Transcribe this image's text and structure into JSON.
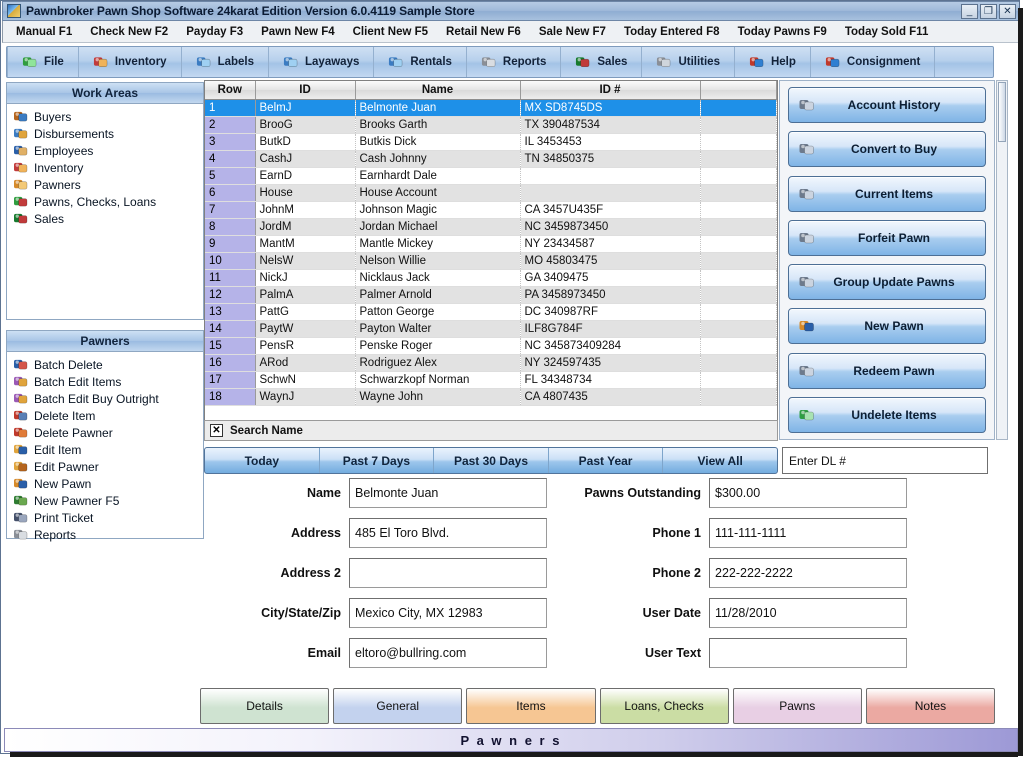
{
  "window": {
    "title": "Pawnbroker Pawn Shop Software 24karat Edition Version 6.0.4119 Sample Store",
    "minimize": "_",
    "maximize": "❐",
    "close": "✕"
  },
  "menubar": {
    "items": [
      {
        "label": "Manual F1"
      },
      {
        "label": "Check New  F2"
      },
      {
        "label": "Payday F3"
      },
      {
        "label": "Pawn New F4"
      },
      {
        "label": "Client New F5"
      },
      {
        "label": "Retail New F6"
      },
      {
        "label": "Sale New F7"
      },
      {
        "label": "Today Entered F8"
      },
      {
        "label": "Today Pawns F9"
      },
      {
        "label": "Today Sold F11"
      }
    ]
  },
  "toolbar": {
    "items": [
      {
        "label": "File",
        "icon": "file-icon"
      },
      {
        "label": "Inventory",
        "icon": "inventory-icon"
      },
      {
        "label": "Labels",
        "icon": "labels-icon"
      },
      {
        "label": "Layaways",
        "icon": "layaways-icon"
      },
      {
        "label": "Rentals",
        "icon": "rentals-icon"
      },
      {
        "label": "Reports",
        "icon": "reports-icon"
      },
      {
        "label": "Sales",
        "icon": "sales-icon"
      },
      {
        "label": "Utilities",
        "icon": "utilities-icon"
      },
      {
        "label": "Help",
        "icon": "help-icon"
      },
      {
        "label": "Consignment",
        "icon": "consignment-icon"
      }
    ]
  },
  "work_areas": {
    "title": "Work Areas",
    "items": [
      {
        "label": "Buyers",
        "icon": "buyers-icon"
      },
      {
        "label": "Disbursements",
        "icon": "disbursements-icon"
      },
      {
        "label": "Employees",
        "icon": "employees-icon"
      },
      {
        "label": "Inventory",
        "icon": "inventory-icon"
      },
      {
        "label": "Pawners",
        "icon": "pawners-icon"
      },
      {
        "label": "Pawns,  Checks,  Loans",
        "icon": "pawns-checks-loans-icon"
      },
      {
        "label": "Sales",
        "icon": "sales-icon"
      }
    ]
  },
  "pawners_panel": {
    "title": "Pawners",
    "items": [
      {
        "label": "Batch Delete",
        "icon": "batch-delete-icon"
      },
      {
        "label": "Batch Edit Items",
        "icon": "batch-edit-items-icon"
      },
      {
        "label": "Batch Edit Buy Outright",
        "icon": "batch-edit-buy-outright-icon"
      },
      {
        "label": "Delete Item",
        "icon": "delete-item-icon"
      },
      {
        "label": "Delete Pawner",
        "icon": "delete-pawner-icon"
      },
      {
        "label": "Edit Item",
        "icon": "edit-item-icon"
      },
      {
        "label": "Edit Pawner",
        "icon": "edit-pawner-icon"
      },
      {
        "label": "New Pawn",
        "icon": "new-pawn-icon"
      },
      {
        "label": "New Pawner  F5",
        "icon": "new-pawner-icon"
      },
      {
        "label": "Print Ticket",
        "icon": "print-ticket-icon"
      },
      {
        "label": "Reports",
        "icon": "reports-icon"
      }
    ]
  },
  "grid": {
    "columns": [
      "Row",
      "ID",
      "Name",
      "ID #",
      ""
    ],
    "selected_row": 1,
    "rows": [
      {
        "row": "1",
        "id": "BelmJ",
        "name": "Belmonte Juan",
        "idnum": "MX SD8745DS",
        "extra": ""
      },
      {
        "row": "2",
        "id": "BrooG",
        "name": "Brooks Garth",
        "idnum": "TX 390487534",
        "extra": ""
      },
      {
        "row": "3",
        "id": "ButkD",
        "name": "Butkis Dick",
        "idnum": "IL 3453453",
        "extra": ""
      },
      {
        "row": "4",
        "id": "CashJ",
        "name": "Cash Johnny",
        "idnum": "TN 34850375",
        "extra": ""
      },
      {
        "row": "5",
        "id": "EarnD",
        "name": "Earnhardt Dale",
        "idnum": "",
        "extra": ""
      },
      {
        "row": "6",
        "id": "House",
        "name": "House Account",
        "idnum": "",
        "extra": ""
      },
      {
        "row": "7",
        "id": "JohnM",
        "name": "Johnson Magic",
        "idnum": "CA 3457U435F",
        "extra": ""
      },
      {
        "row": "8",
        "id": "JordM",
        "name": "Jordan Michael",
        "idnum": "NC 3459873450",
        "extra": ""
      },
      {
        "row": "9",
        "id": "MantM",
        "name": "Mantle Mickey",
        "idnum": "NY 23434587",
        "extra": ""
      },
      {
        "row": "10",
        "id": "NelsW",
        "name": "Nelson Willie",
        "idnum": "MO 45803475",
        "extra": ""
      },
      {
        "row": "11",
        "id": "NickJ",
        "name": "Nicklaus Jack",
        "idnum": "GA 3409475",
        "extra": ""
      },
      {
        "row": "12",
        "id": "PalmA",
        "name": "Palmer Arnold",
        "idnum": "PA 3458973450",
        "extra": ""
      },
      {
        "row": "13",
        "id": "PattG",
        "name": "Patton George",
        "idnum": "DC 340987RF",
        "extra": ""
      },
      {
        "row": "14",
        "id": "PaytW",
        "name": "Payton Walter",
        "idnum": "ILF8G784F",
        "extra": ""
      },
      {
        "row": "15",
        "id": "PensR",
        "name": "Penske Roger",
        "idnum": "NC 345873409284",
        "extra": ""
      },
      {
        "row": "16",
        "id": "ARod",
        "name": "Rodriguez Alex",
        "idnum": "NY 324597435",
        "extra": ""
      },
      {
        "row": "17",
        "id": "SchwN",
        "name": "Schwarzkopf Norman",
        "idnum": "FL 34348734",
        "extra": ""
      },
      {
        "row": "18",
        "id": "WaynJ",
        "name": "Wayne John",
        "idnum": "CA 4807435",
        "extra": ""
      }
    ]
  },
  "search": {
    "clear_label": "✕",
    "label": "Search Name"
  },
  "actions": {
    "buttons": [
      {
        "label": "Account History",
        "icon": "account-history-icon"
      },
      {
        "label": "Convert to Buy",
        "icon": "convert-to-buy-icon"
      },
      {
        "label": "Current Items",
        "icon": "current-items-icon"
      },
      {
        "label": "Forfeit Pawn",
        "icon": "forfeit-pawn-icon"
      },
      {
        "label": "Group Update Pawns",
        "icon": "group-update-pawns-icon"
      },
      {
        "label": "New Pawn",
        "icon": "new-pawn-icon"
      },
      {
        "label": "Redeem Pawn",
        "icon": "redeem-pawn-icon"
      },
      {
        "label": "Undelete Items",
        "icon": "undelete-items-icon"
      }
    ]
  },
  "filters": {
    "buttons": [
      "Today",
      "Past 7 Days",
      "Past 30 Days",
      "Past Year",
      "View All"
    ]
  },
  "dl_field": {
    "placeholder": "Enter DL #",
    "value": "Enter DL #"
  },
  "form": {
    "left": [
      {
        "label": "Name",
        "value": "Belmonte Juan"
      },
      {
        "label": "Address",
        "value": "485 El Toro Blvd."
      },
      {
        "label": "Address 2",
        "value": ""
      },
      {
        "label": "City/State/Zip",
        "value": "Mexico City, MX 12983"
      },
      {
        "label": "Email",
        "value": "eltoro@bullring.com"
      }
    ],
    "right": [
      {
        "label": "Pawns Outstanding",
        "value": "$300.00"
      },
      {
        "label": "Phone 1",
        "value": "111-111-1111"
      },
      {
        "label": "Phone 2",
        "value": "222-222-2222"
      },
      {
        "label": "User Date",
        "value": "11/28/2010"
      },
      {
        "label": "User Text",
        "value": ""
      }
    ]
  },
  "tabs": {
    "items": [
      {
        "label": "Details",
        "color": "#cfe3d1"
      },
      {
        "label": "General",
        "color": "#c3d2ee"
      },
      {
        "label": "Items",
        "color": "#f6c693"
      },
      {
        "label": "Loans, Checks",
        "color": "#cbdda4"
      },
      {
        "label": "Pawns",
        "color": "#e8cfe4"
      },
      {
        "label": "Notes",
        "color": "#eba9a2"
      }
    ]
  },
  "statusbar": {
    "text": "P a w n e r s"
  }
}
